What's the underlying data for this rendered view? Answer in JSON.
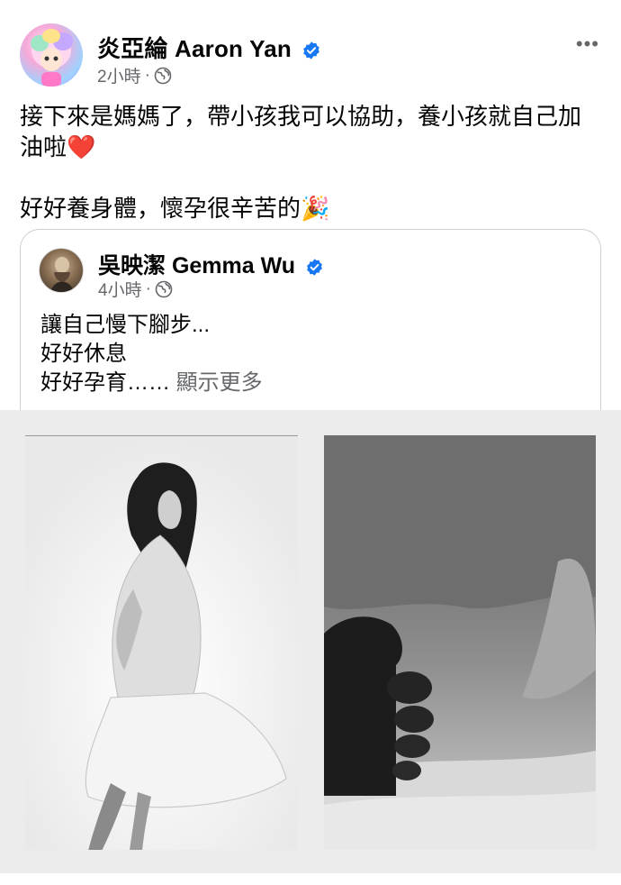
{
  "post": {
    "author": "炎亞綸 Aaron Yan",
    "time": "2小時",
    "separator": "·",
    "more_label": "•••",
    "text_lines": [
      "接下來是媽媽了，帶小孩我可以協助，養小孩就自己加",
      "油啦❤️",
      "好好養身體，懷孕很辛苦的🎉"
    ]
  },
  "shared": {
    "author": "吳映潔 Gemma Wu",
    "time": "4小時",
    "separator": "·",
    "lines": [
      "讓自己慢下腳步...",
      "好好休息",
      "好好孕育……"
    ],
    "see_more": "顯示更多"
  },
  "colors": {
    "verified_blue": "#1877f2",
    "meta_gray": "#65676b",
    "photo_bg": "#ececec"
  },
  "icons": {
    "audience": "globe-icon",
    "verified": "verified-badge-icon",
    "more": "more-options-icon"
  }
}
